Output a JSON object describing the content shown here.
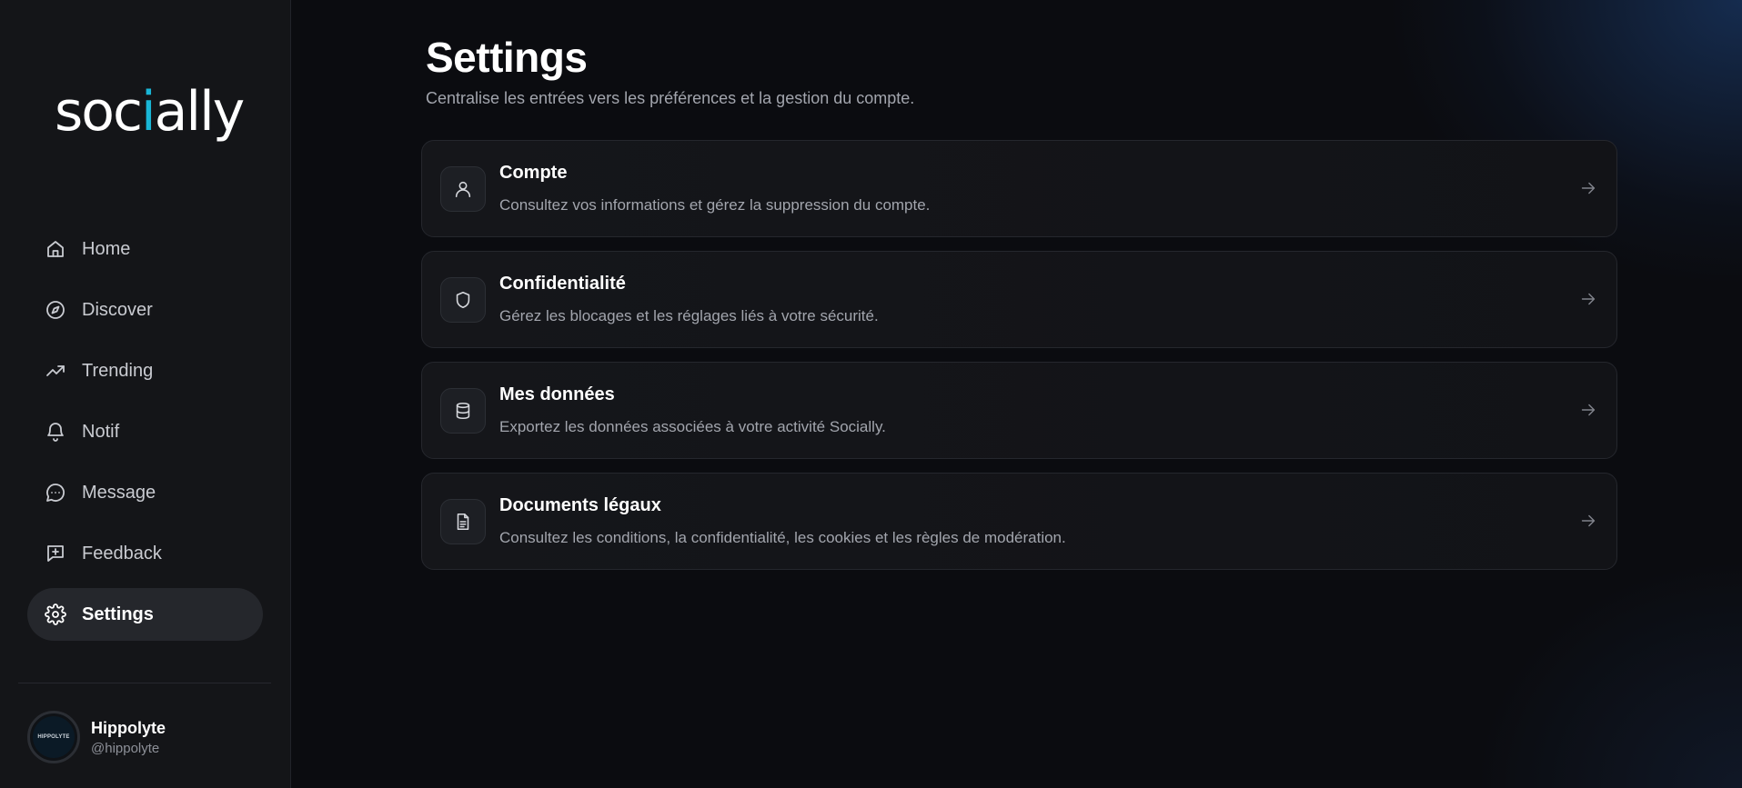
{
  "app": {
    "logo_prefix": "soc",
    "logo_accent": "i",
    "logo_suffix": "ally",
    "accent_color": "#19b6d6"
  },
  "sidebar": {
    "items": [
      {
        "label": "Home",
        "icon": "home-icon",
        "active": false
      },
      {
        "label": "Discover",
        "icon": "compass-icon",
        "active": false
      },
      {
        "label": "Trending",
        "icon": "trending-up-icon",
        "active": false
      },
      {
        "label": "Notif",
        "icon": "bell-icon",
        "active": false
      },
      {
        "label": "Message",
        "icon": "message-circle-icon",
        "active": false
      },
      {
        "label": "Feedback",
        "icon": "message-plus-icon",
        "active": false
      },
      {
        "label": "Settings",
        "icon": "gear-icon",
        "active": true
      }
    ]
  },
  "profile": {
    "name": "Hippolyte",
    "handle": "@hippolyte",
    "avatar_text": "HIPPOLYTE"
  },
  "main": {
    "title": "Settings",
    "subtitle": "Centralise les entrées vers les préférences et la gestion du compte.",
    "cards": [
      {
        "title": "Compte",
        "description": "Consultez vos informations et gérez la suppression du compte.",
        "icon": "user-icon"
      },
      {
        "title": "Confidentialité",
        "description": "Gérez les blocages et les réglages liés à votre sécurité.",
        "icon": "shield-icon"
      },
      {
        "title": "Mes données",
        "description": "Exportez les données associées à votre activité Socially.",
        "icon": "database-icon"
      },
      {
        "title": "Documents légaux",
        "description": "Consultez les conditions, la confidentialité, les cookies et les règles de modération.",
        "icon": "document-icon"
      }
    ]
  }
}
